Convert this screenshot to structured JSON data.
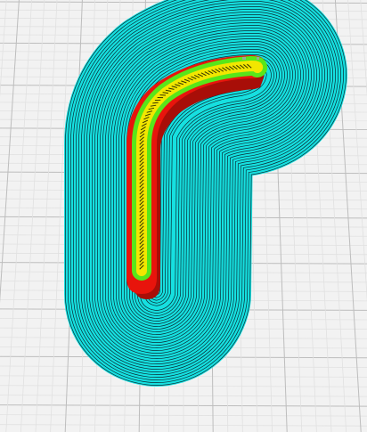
{
  "viewport": {
    "view": "slicer-layer-preview",
    "background_color": "#f2f2f2",
    "grid": {
      "minor_line_color": "#e1e1e1",
      "major_line_color": "#bdbdbd"
    }
  },
  "toolpaths": {
    "brim": {
      "fill_color": "#16e0e0",
      "line_color": "#0a2a33"
    },
    "support_wall": {
      "fill_color": "#e8140c",
      "shadow_color": "#a80e08"
    },
    "outer_perimeter": {
      "color": "#58e61a"
    },
    "inner_perimeter": {
      "color": "#f2e600"
    },
    "infill": {
      "color": "#333300"
    }
  }
}
